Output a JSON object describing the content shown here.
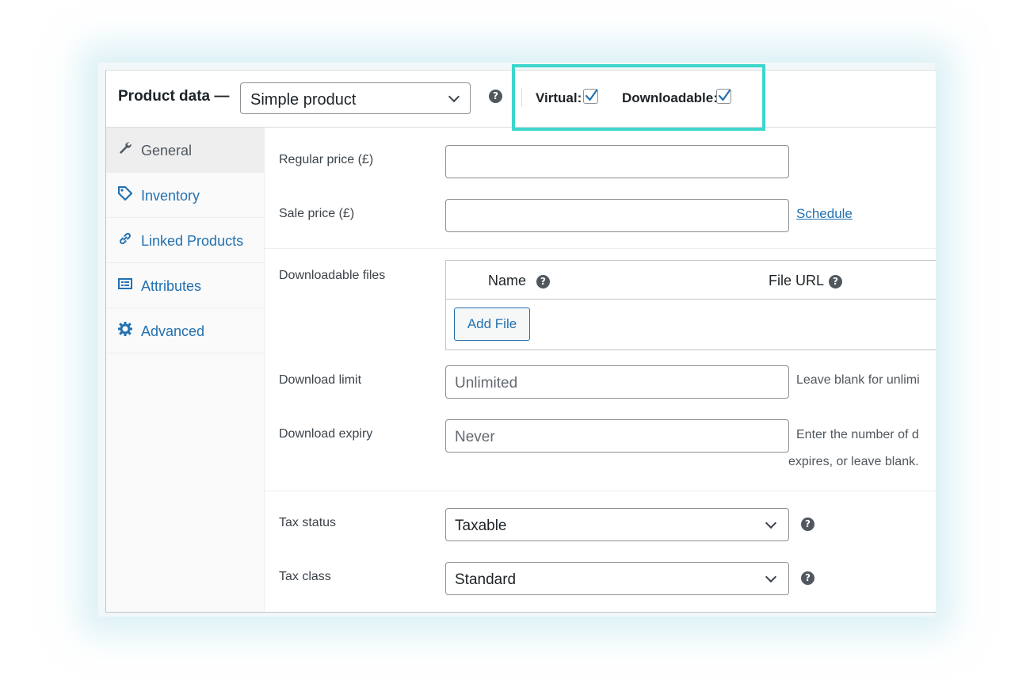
{
  "header": {
    "title": "Product data —",
    "product_type": "Simple product",
    "virtual_label": "Virtual:",
    "virtual_checked": true,
    "downloadable_label": "Downloadable:",
    "downloadable_checked": true
  },
  "sidebar": {
    "items": [
      {
        "label": "General",
        "icon": "wrench-icon",
        "active": true
      },
      {
        "label": "Inventory",
        "icon": "tag-icon",
        "active": false
      },
      {
        "label": "Linked Products",
        "icon": "link-icon",
        "active": false
      },
      {
        "label": "Attributes",
        "icon": "list-icon",
        "active": false
      },
      {
        "label": "Advanced",
        "icon": "gear-icon",
        "active": false
      }
    ]
  },
  "general": {
    "regular_price_label": "Regular price (£)",
    "regular_price_value": "",
    "sale_price_label": "Sale price (£)",
    "sale_price_value": "",
    "schedule_link": "Schedule",
    "downloadable_files_label": "Downloadable files",
    "files_table": {
      "col_name": "Name",
      "col_url": "File URL",
      "add_file_button": "Add File"
    },
    "download_limit_label": "Download limit",
    "download_limit_placeholder": "Unlimited",
    "download_limit_desc": "Leave blank for unlimi",
    "download_expiry_label": "Download expiry",
    "download_expiry_placeholder": "Never",
    "download_expiry_desc_1": "Enter the number of d",
    "download_expiry_desc_2": "expires, or leave blank.",
    "tax_status_label": "Tax status",
    "tax_status_value": "Taxable",
    "tax_class_label": "Tax class",
    "tax_class_value": "Standard"
  },
  "colors": {
    "accent": "#2271b1",
    "highlight": "#3dd6cc"
  }
}
